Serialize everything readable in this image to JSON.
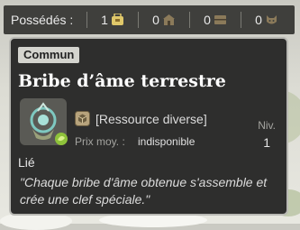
{
  "owned": {
    "label": "Possédés :",
    "items": [
      {
        "count": "1",
        "icon": "bag-icon",
        "color": "#e0c86a"
      },
      {
        "count": "0",
        "icon": "chest-icon",
        "color": "#8b7a5a"
      },
      {
        "count": "0",
        "icon": "storage-icon",
        "color": "#8b7a5a"
      },
      {
        "count": "0",
        "icon": "pet-icon",
        "color": "#8b7a5a"
      }
    ]
  },
  "item": {
    "rarity": "Commun",
    "name": "Bribe d’âme terrestre",
    "type": "[Ressource diverse]",
    "price_label": "Prix moy. :",
    "price_value": "indisponible",
    "level_label": "Niv.",
    "level": "1",
    "bound": "Lié",
    "description": "\"Chaque bribe d'âme obtenue s'assemble et crée une clef spéciale.\""
  },
  "colors": {
    "card_bg": "#2e2e2d",
    "bar_bg": "#3f3f3c",
    "rarity_bg": "#d4d4ce"
  }
}
